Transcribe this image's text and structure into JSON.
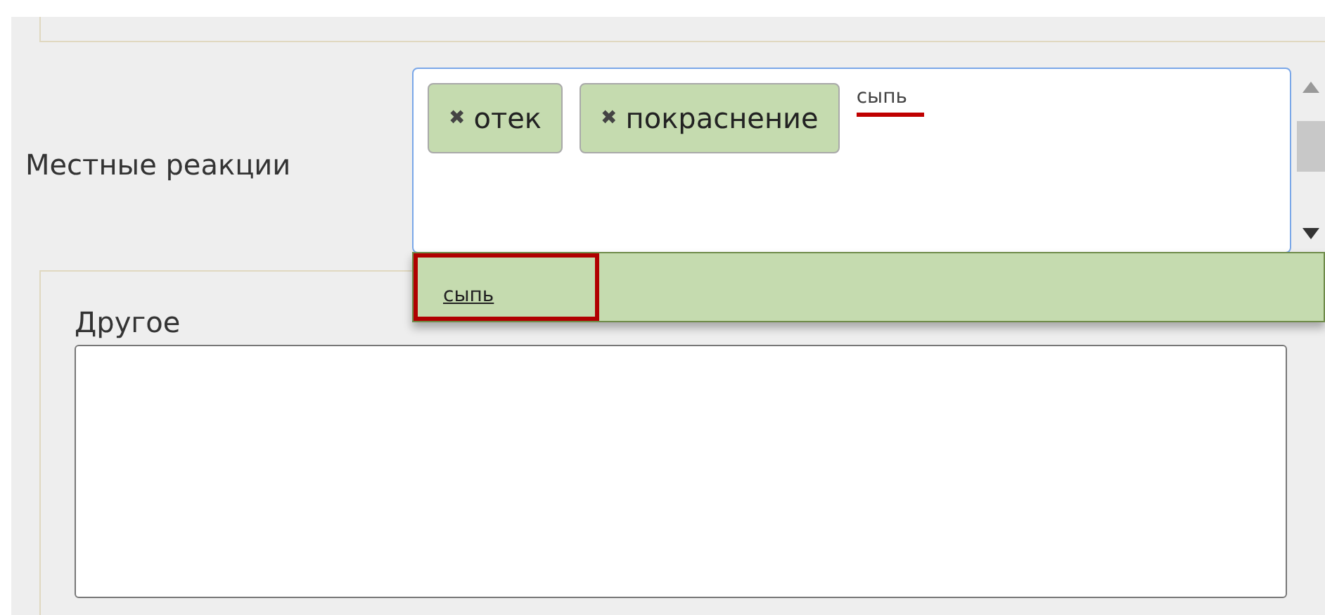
{
  "local_reactions": {
    "label": "Местные реакции",
    "tags": [
      {
        "text": "отек",
        "remove_icon": "✖"
      },
      {
        "text": "покраснение",
        "remove_icon": "✖"
      }
    ],
    "typed_value": "сыпь",
    "typed_marked": true,
    "suggestions": [
      {
        "text": "сыпь",
        "selected": true
      }
    ]
  },
  "other": {
    "label": "Другое"
  }
}
